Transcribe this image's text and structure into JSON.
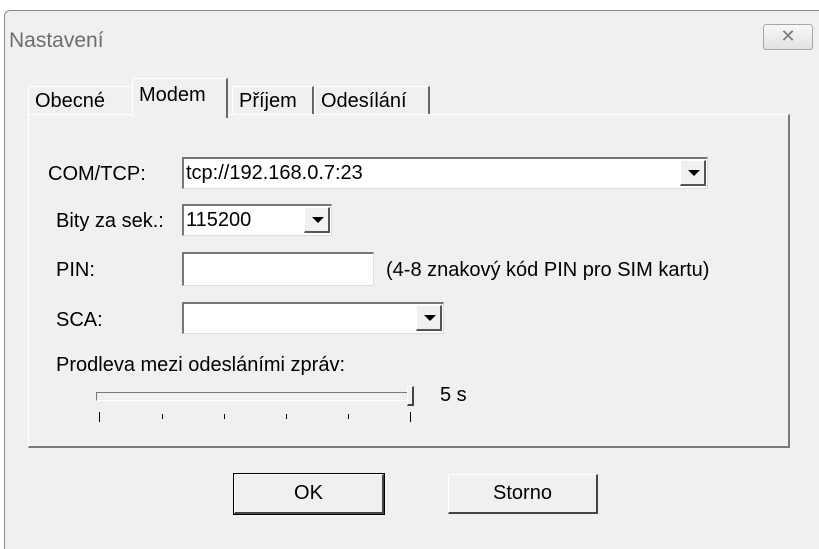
{
  "window": {
    "title": "Nastavení",
    "close_glyph": "✕"
  },
  "tabs": [
    {
      "label": "Obecné"
    },
    {
      "label": "Modem"
    },
    {
      "label": "Příjem"
    },
    {
      "label": "Odesílání"
    }
  ],
  "active_tab": "Modem",
  "form": {
    "com_tcp": {
      "label": "COM/TCP:",
      "value": "tcp://192.168.0.7:23"
    },
    "baud": {
      "label": "Bity za sek.:",
      "value": "115200"
    },
    "pin": {
      "label": "PIN:",
      "value": "",
      "hint": "(4-8 znakový kód PIN pro SIM kartu)"
    },
    "sca": {
      "label": "SCA:",
      "value": ""
    },
    "delay": {
      "label": "Prodleva mezi odesláními zpráv:",
      "value_text": "5 s",
      "level": 1.0
    }
  },
  "buttons": {
    "ok": "OK",
    "cancel": "Storno"
  }
}
